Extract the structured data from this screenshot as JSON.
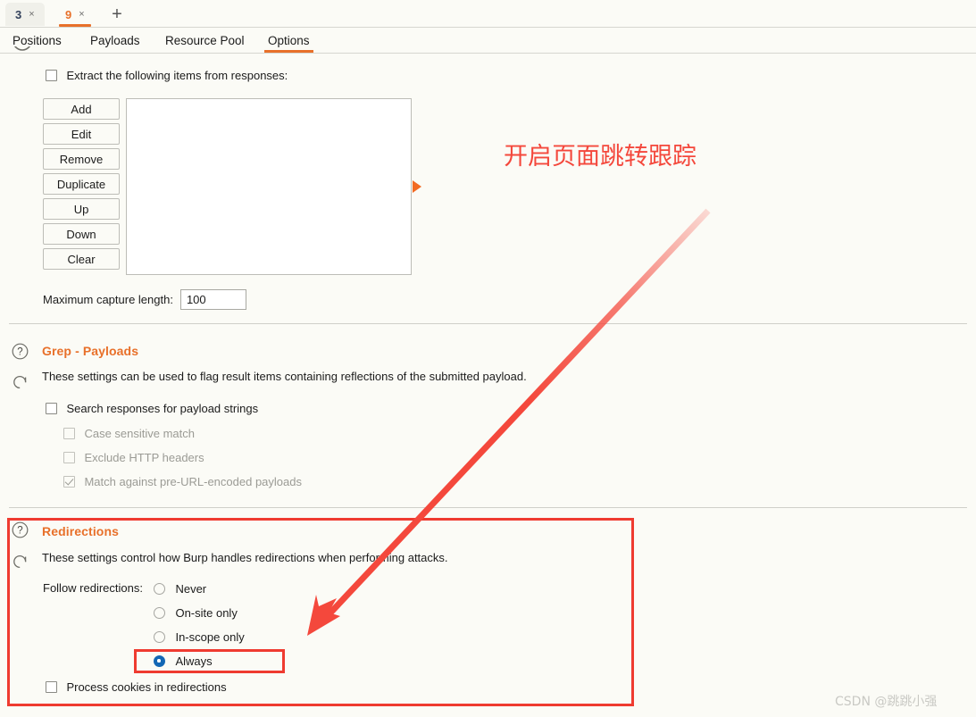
{
  "window_tabs": [
    {
      "label": "3",
      "close": "×",
      "active": false
    },
    {
      "label": "9",
      "close": "×",
      "active": true
    }
  ],
  "new_tab_label": "+",
  "section_tabs": [
    {
      "label": "Positions",
      "active": false
    },
    {
      "label": "Payloads",
      "active": false
    },
    {
      "label": "Resource Pool",
      "active": false
    },
    {
      "label": "Options",
      "active": true
    }
  ],
  "grep_extract": {
    "checkbox_label": "Extract the following items from responses:",
    "checked": false,
    "buttons": [
      "Add",
      "Edit",
      "Remove",
      "Duplicate",
      "Up",
      "Down",
      "Clear"
    ],
    "list_items": [],
    "max_capture_label": "Maximum capture length:",
    "max_capture_value": "100",
    "expander_icon": "triangle-right-icon"
  },
  "grep_payloads": {
    "title": "Grep - Payloads",
    "description": "These settings can be used to flag result items containing reflections of the submitted payload.",
    "options": [
      {
        "label": "Search responses for payload strings",
        "checked": false,
        "disabled": false
      },
      {
        "label": "Case sensitive match",
        "checked": false,
        "disabled": true
      },
      {
        "label": "Exclude HTTP headers",
        "checked": false,
        "disabled": true
      },
      {
        "label": "Match against pre-URL-encoded payloads",
        "checked": true,
        "disabled": true
      }
    ]
  },
  "redirections": {
    "title": "Redirections",
    "description": "These settings control how Burp handles redirections when performing attacks.",
    "follow_label": "Follow redirections:",
    "radios": [
      {
        "label": "Never",
        "selected": false
      },
      {
        "label": "On-site only",
        "selected": false
      },
      {
        "label": "In-scope only",
        "selected": false
      },
      {
        "label": "Always",
        "selected": true
      }
    ],
    "process_cookies": {
      "label": "Process cookies in redirections",
      "checked": false
    }
  },
  "annotations": {
    "callout_text": "开启页面跳转跟踪",
    "callout_color": "#f4483c",
    "highlight_color": "#ef3b30",
    "arrow_color": "#f4483c",
    "watermark": "CSDN @跳跳小强"
  },
  "colors": {
    "accent": "#e8702a",
    "background": "#fbfbf6",
    "radio_selected": "#1367b5",
    "text": "#1b1b1b"
  }
}
